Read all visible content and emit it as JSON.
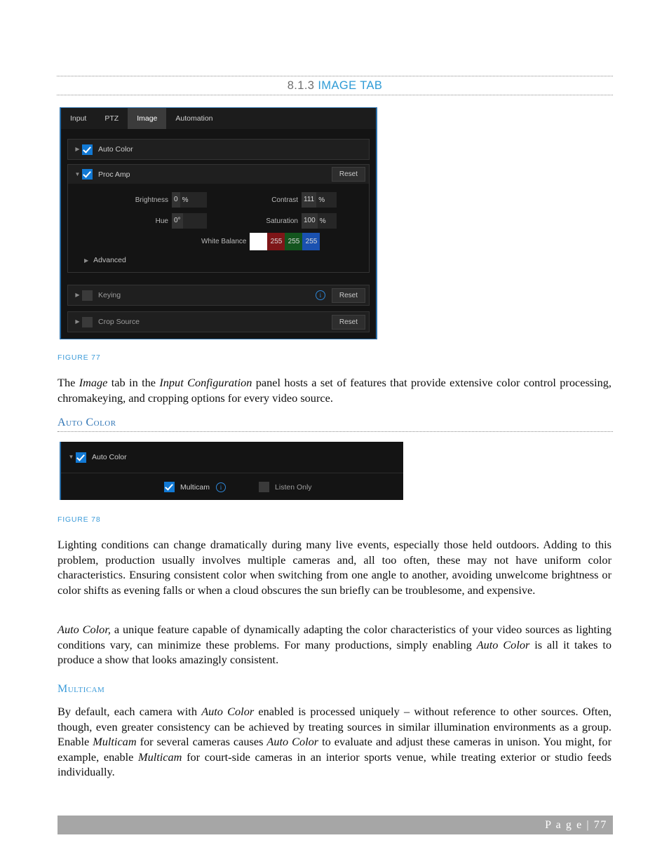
{
  "section": {
    "number": "8.1.3",
    "title": "IMAGE TAB"
  },
  "figure77": {
    "caption": "FIGURE 77",
    "tabs": [
      {
        "label": "Input",
        "active": false
      },
      {
        "label": "PTZ",
        "active": false
      },
      {
        "label": "Image",
        "active": true
      },
      {
        "label": "Automation",
        "active": false
      }
    ],
    "rows": {
      "auto_color": {
        "label": "Auto Color",
        "checked": true,
        "expander": "collapsed"
      },
      "proc_amp": {
        "label": "Proc Amp",
        "checked": true,
        "expander": "expanded",
        "reset_label": "Reset"
      },
      "keying": {
        "label": "Keying",
        "checked": false,
        "expander": "collapsed",
        "info_icon": "info-icon",
        "reset_label": "Reset"
      },
      "crop_source": {
        "label": "Crop Source",
        "checked": false,
        "expander": "collapsed",
        "reset_label": "Reset"
      }
    },
    "proc_amp_fields": {
      "brightness": {
        "label": "Brightness",
        "value": "0",
        "unit": "%"
      },
      "contrast": {
        "label": "Contrast",
        "value": "111",
        "unit": "%"
      },
      "hue": {
        "label": "Hue",
        "value": "0°",
        "unit": ""
      },
      "saturation": {
        "label": "Saturation",
        "value": "100",
        "unit": "%"
      },
      "white_balance": {
        "label": "White Balance",
        "swatches": [
          {
            "name": "white",
            "value": "",
            "color": "#ffffff"
          },
          {
            "name": "red",
            "value": "255",
            "color": "#7e1618"
          },
          {
            "name": "green",
            "value": "255",
            "color": "#14551e"
          },
          {
            "name": "blue",
            "value": "255",
            "color": "#1a51b0"
          }
        ]
      },
      "advanced": {
        "label": "Advanced"
      }
    }
  },
  "figure78": {
    "caption": "FIGURE 78",
    "header": {
      "label": "Auto Color",
      "checked": true,
      "expander": "expanded"
    },
    "options": [
      {
        "label": "Multicam",
        "checked": true,
        "has_info": true
      },
      {
        "label": "Listen Only",
        "checked": false,
        "has_info": false
      }
    ]
  },
  "headings": {
    "auto_color": "Auto Color",
    "multicam": "Multicam"
  },
  "paragraphs": {
    "intro_a": "The ",
    "intro_b": "Image",
    "intro_c": " tab in the ",
    "intro_d": "Input Configuration",
    "intro_e": " panel hosts a set of features that provide extensive color control processing, chromakeying, and cropping options for every video source.",
    "lighting": "Lighting conditions can change dramatically during many live events, especially those held outdoors. Adding to this problem, production usually involves multiple cameras and, all too often, these may not have uniform color characteristics. Ensuring consistent color when switching from one angle to another, avoiding unwelcome brightness or color shifts as evening falls or when a cloud obscures the sun briefly can be troublesome, and expensive.",
    "autocolor_a": "Auto Color,",
    "autocolor_b": " a unique feature capable of dynamically adapting the color characteristics of your video sources as lighting conditions vary, can minimize these problems.  For many productions, simply enabling ",
    "autocolor_c": "Auto Color",
    "autocolor_d": " is all it takes to produce a show that looks amazingly consistent.",
    "multicam_a": "By default, each camera with ",
    "multicam_b": "Auto Color",
    "multicam_c": " enabled is processed uniquely – without reference to other sources. Often, though, even greater consistency can be achieved by treating sources in similar illumination environments as a group.  Enable ",
    "multicam_d": "Multicam",
    "multicam_e": " for several cameras causes ",
    "multicam_f": "Auto Color",
    "multicam_g": " to evaluate and adjust these cameras in unison.  You might, for example, enable ",
    "multicam_h": "Multicam",
    "multicam_i": " for court-side cameras in an interior sports venue, while treating exterior or studio feeds individually."
  },
  "footer": {
    "page_text": "P a g e  | 77"
  },
  "colors": {
    "accent_blue": "#2e9bd6",
    "heading_blue": "#2e74b5",
    "checkbox_blue": "#1279d4",
    "panel_border": "#2a6ea8",
    "footer_bar": "#a6a6a6"
  }
}
